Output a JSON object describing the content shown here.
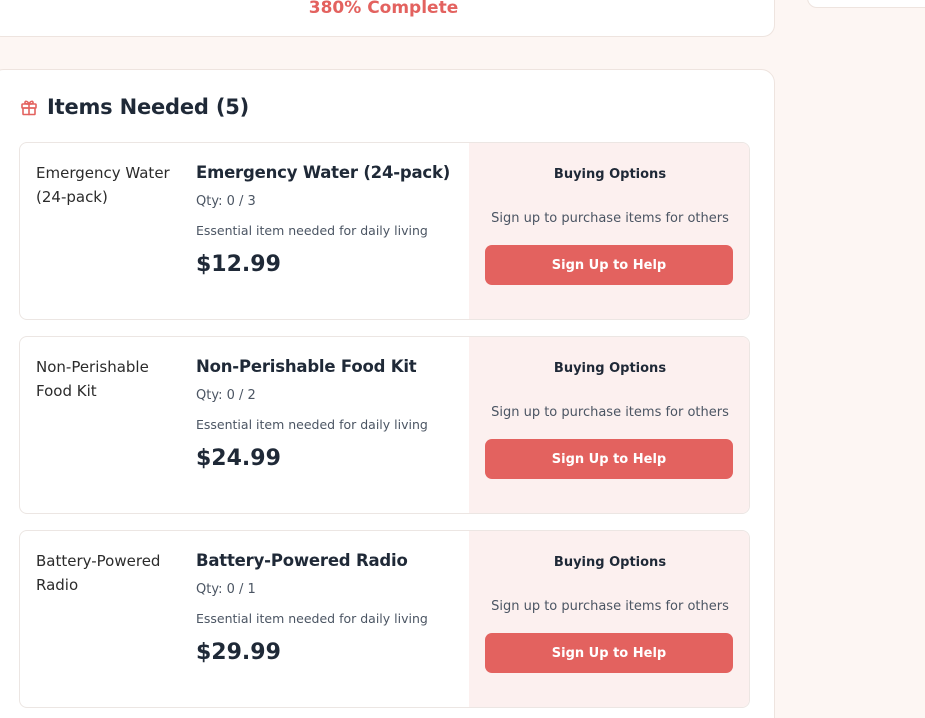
{
  "progress": {
    "text": "380% Complete",
    "percent": 380
  },
  "items_section": {
    "title": "Items Needed (5)",
    "icon": "gift-icon",
    "accent_color": "#e3625f",
    "items": [
      {
        "left_name": "Emergency Water (24-pack)",
        "title": "Emergency Water (24-pack)",
        "qty": "Qty: 0 / 3",
        "description": "Essential item needed for daily living",
        "price": "$12.99",
        "buy_title": "Buying Options",
        "buy_sub": "Sign up to purchase items for others",
        "button": "Sign Up to Help"
      },
      {
        "left_name": "Non-Perishable Food Kit",
        "title": "Non-Perishable Food Kit",
        "qty": "Qty: 0 / 2",
        "description": "Essential item needed for daily living",
        "price": "$24.99",
        "buy_title": "Buying Options",
        "buy_sub": "Sign up to purchase items for others",
        "button": "Sign Up to Help"
      },
      {
        "left_name": "Battery-Powered Radio",
        "title": "Battery-Powered Radio",
        "qty": "Qty: 0 / 1",
        "description": "Essential item needed for daily living",
        "price": "$29.99",
        "buy_title": "Buying Options",
        "buy_sub": "Sign up to purchase items for others",
        "button": "Sign Up to Help"
      }
    ]
  }
}
